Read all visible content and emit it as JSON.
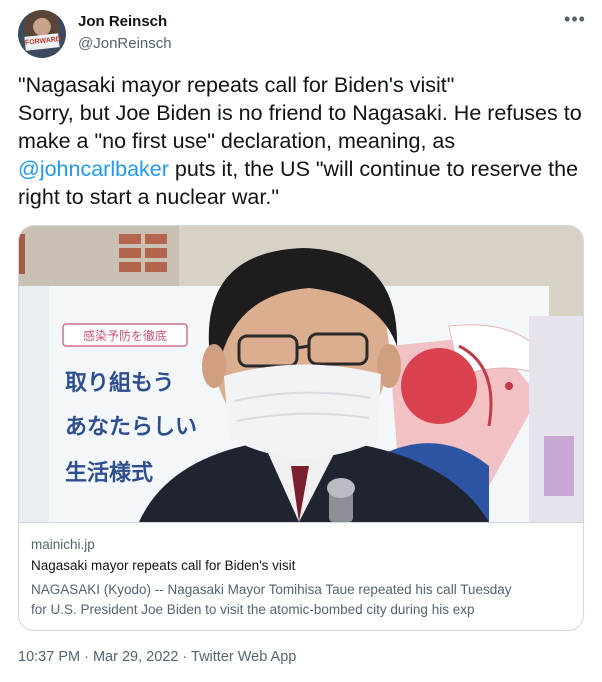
{
  "author": {
    "name": "Jon Reinsch",
    "handle": "@JonReinsch",
    "avatar_sign": "FORWARD"
  },
  "menu": {
    "more_icon": "more-horizontal-icon",
    "more_glyph": "•••"
  },
  "tweet": {
    "line1": "\"Nagasaki mayor repeats call for Biden's visit\"",
    "text_part1": "Sorry, but Joe Biden is no friend to Nagasaki. He refuses to make a \"no first use\" declaration, meaning, as ",
    "mention": "@johncarlbaker",
    "text_part2": " puts it, the US \"will continue to reserve the right to start a nuclear war.\""
  },
  "card": {
    "image_text": {
      "line1": "感染予防を徹底",
      "line2": "取り組もう",
      "line3": "あなたらしい",
      "line4": "生活様式"
    },
    "domain": "mainichi.jp",
    "title": "Nagasaki mayor repeats call for Biden's visit",
    "description_line1": "NAGASAKI (Kyodo) -- Nagasaki Mayor Tomihisa Taue repeated his call Tuesday",
    "description_line2": "for U.S. President Joe Biden to visit the atomic-bombed city during his exp"
  },
  "footer": {
    "timestamp": "10:37 PM · Mar 29, 2022 · Twitter Web App"
  },
  "colors": {
    "link": "#1d9bf0",
    "secondary_text": "#536471",
    "border": "#cfd9de"
  }
}
